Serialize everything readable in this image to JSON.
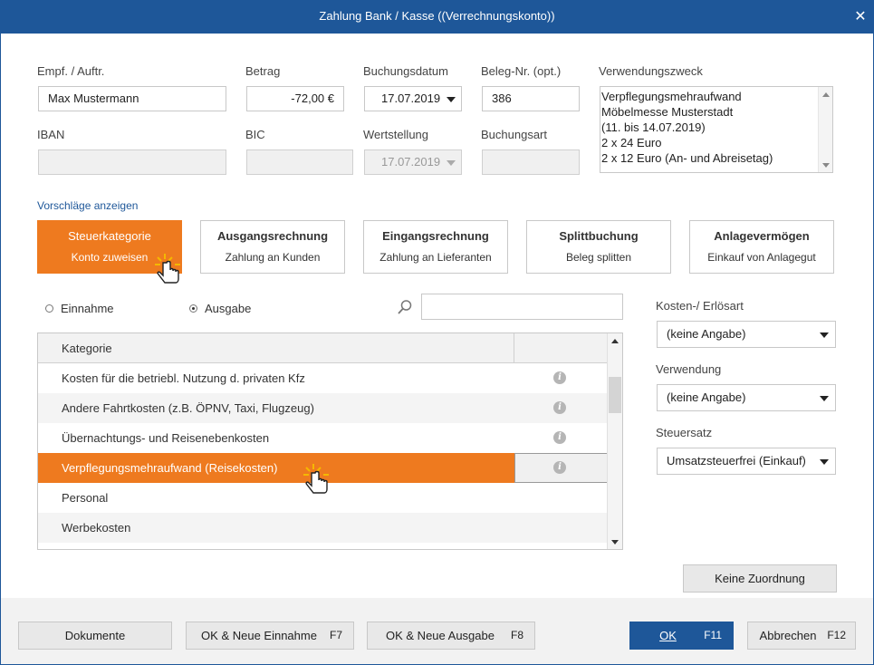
{
  "window": {
    "title": "Zahlung Bank / Kasse ((Verrechnungskonto))",
    "close_glyph": "✕"
  },
  "form": {
    "empf_label": "Empf. / Auftr.",
    "empf_value": "Max Mustermann",
    "betrag_label": "Betrag",
    "betrag_value": "-72,00 €",
    "buchungsdatum_label": "Buchungsdatum",
    "buchungsdatum_value": "17.07.2019",
    "beleg_label": "Beleg-Nr. (opt.)",
    "beleg_value": "386",
    "verwendungszweck_label": "Verwendungszweck",
    "verwendungszweck_lines": [
      "Verpflegungsmehraufwand",
      "Möbelmesse Musterstadt",
      "(11. bis 14.07.2019)",
      "2 x 24 Euro",
      "2 x 12 Euro (An- und Abreisetag)"
    ],
    "iban_label": "IBAN",
    "iban_value": "",
    "bic_label": "BIC",
    "bic_value": "",
    "wertstellung_label": "Wertstellung",
    "wertstellung_value": "17.07.2019",
    "buchungsart_label": "Buchungsart",
    "buchungsart_value": ""
  },
  "suggestions": {
    "link": "Vorschläge anzeigen",
    "cards": [
      {
        "title": "Steuerkategorie",
        "subtitle": "Konto zuweisen",
        "active": true
      },
      {
        "title": "Ausgangsrechnung",
        "subtitle": "Zahlung an Kunden",
        "active": false
      },
      {
        "title": "Eingangsrechnung",
        "subtitle": "Zahlung an Lieferanten",
        "active": false
      },
      {
        "title": "Splittbuchung",
        "subtitle": "Beleg splitten",
        "active": false
      },
      {
        "title": "Anlagevermögen",
        "subtitle": "Einkauf von Anlagegut",
        "active": false
      }
    ]
  },
  "filter": {
    "einnahme_label": "Einnahme",
    "ausgabe_label": "Ausgabe",
    "selected": "Ausgabe",
    "search_value": ""
  },
  "table": {
    "header": "Kategorie",
    "rows": [
      "Kosten für die betriebl. Nutzung d. privaten Kfz",
      "Andere Fahrtkosten (z.B. ÖPNV, Taxi, Flugzeug)",
      "Übernachtungs- und Reisenebenkosten",
      "Verpflegungsmehraufwand (Reisekosten)",
      "Personal",
      "Werbekosten"
    ],
    "selected_index": 3,
    "info_glyph": "i"
  },
  "right_panel": {
    "kosten_label": "Kosten-/ Erlösart",
    "kosten_value": "(keine Angabe)",
    "verwendung_label": "Verwendung",
    "verwendung_value": "(keine Angabe)",
    "steuersatz_label": "Steuersatz",
    "steuersatz_value": "Umsatzsteuerfrei (Einkauf)",
    "keine_zuordnung": "Keine Zuordnung"
  },
  "footer": {
    "dokumente": "Dokumente",
    "ok_neue_einnahme": "OK & Neue Einnahme",
    "ok_neue_einnahme_key": "F7",
    "ok_neue_ausgabe": "OK & Neue Ausgabe",
    "ok_neue_ausgabe_key": "F8",
    "ok": "OK",
    "ok_key": "F11",
    "abbrechen": "Abbrechen",
    "abbrechen_key": "F12"
  },
  "colors": {
    "accent": "#1e5799",
    "highlight": "#ee7a1f"
  }
}
